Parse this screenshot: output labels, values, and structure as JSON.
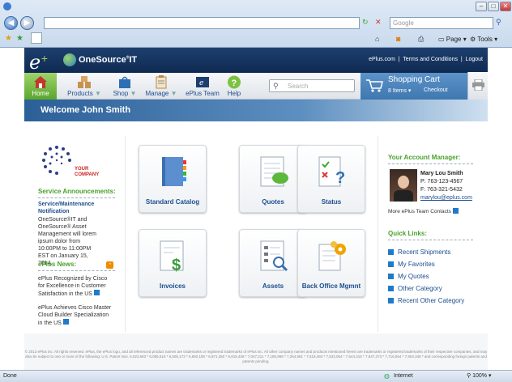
{
  "browser": {
    "search_placeholder": "Google",
    "toolbar_page": "Page",
    "toolbar_tools": "Tools",
    "status_left": "Done",
    "status_zone": "Internet",
    "zoom": "100%"
  },
  "header": {
    "logo_e": "e",
    "logo_plus": "+",
    "brand": "OneSource",
    "brand_suffix": "IT",
    "links": [
      "ePlus.com",
      "Terms and Conditions",
      "Logout"
    ],
    "link_sep": "|"
  },
  "nav": {
    "items": [
      {
        "label": "Home"
      },
      {
        "label": "Products"
      },
      {
        "label": "Shop"
      },
      {
        "label": "Manage"
      },
      {
        "label": "ePlus Team"
      },
      {
        "label": "Help"
      }
    ],
    "search_placeholder": "Search",
    "cart_title": "Shopping Cart",
    "cart_items": "8 Items",
    "checkout": "Checkout"
  },
  "welcome": "Welcome John Smith",
  "left": {
    "company_logo_text": "YOUR",
    "company_logo_text2": "COMPANY",
    "service_heading": "Service Announcements:",
    "notice_title": "Service/Maintenance Notification",
    "notice_body": "OneSource®IT and OneSource® Asset Management will lorem ipsum dolor from 10:00PM to 11:00PM EST on January 15, 2014.",
    "news_heading": "ePlus News:",
    "news": [
      "ePlus Recognized by Cisco for Excellence in Customer Satisfaction in the US",
      "ePlus Achieves Cisco Master Cloud Builder Specialization in the US"
    ]
  },
  "tiles": [
    {
      "label": "Standard Catalog"
    },
    {
      "label": "Quotes"
    },
    {
      "label": "Status"
    },
    {
      "label": "Invoices"
    },
    {
      "label": "Assets"
    },
    {
      "label": "Back Office Mgmnt"
    }
  ],
  "account": {
    "heading": "Your Account Manager:",
    "name": "Mary Lou Smith",
    "phone": "P: 763-123-4567",
    "fax": "F: 763-321-5432",
    "email": "marylou@eplus.com",
    "more": "More ePlus Team Contacts"
  },
  "quick_links": {
    "heading": "Quick Links:",
    "items": [
      "Recent Shipments",
      "My Favorites",
      "My Quotes",
      "Other Category",
      "Recent Other Category"
    ]
  },
  "footer": "© 2013 ePlus inc. All rights reserved. ePlus, the ePlus logo, and all referenced product names are trademarks or registered trademarks of ePlus inc. All other company names and products mentioned herein are trademarks or registered trademarks of their respective companies, and may also be subject to one or more of the following: U.S. Patent Nos. 6,023,683 * 6,055,516 * 6,505,172 * 6,892,185 * 6,871,350 * 6,615,408 * 7,047,211 * 7,185,989 * 7,254,581 * 7,519,484 * 7,533,054 * 7,644,315 * 7,647,373 * 7,716,564 * 7,904,348 * and corresponding foreign patents and patents pending.",
  "colors": {
    "accent_green": "#4aa02c",
    "brand_blue": "#1d3f6e",
    "link_blue": "#1d4e8f"
  }
}
